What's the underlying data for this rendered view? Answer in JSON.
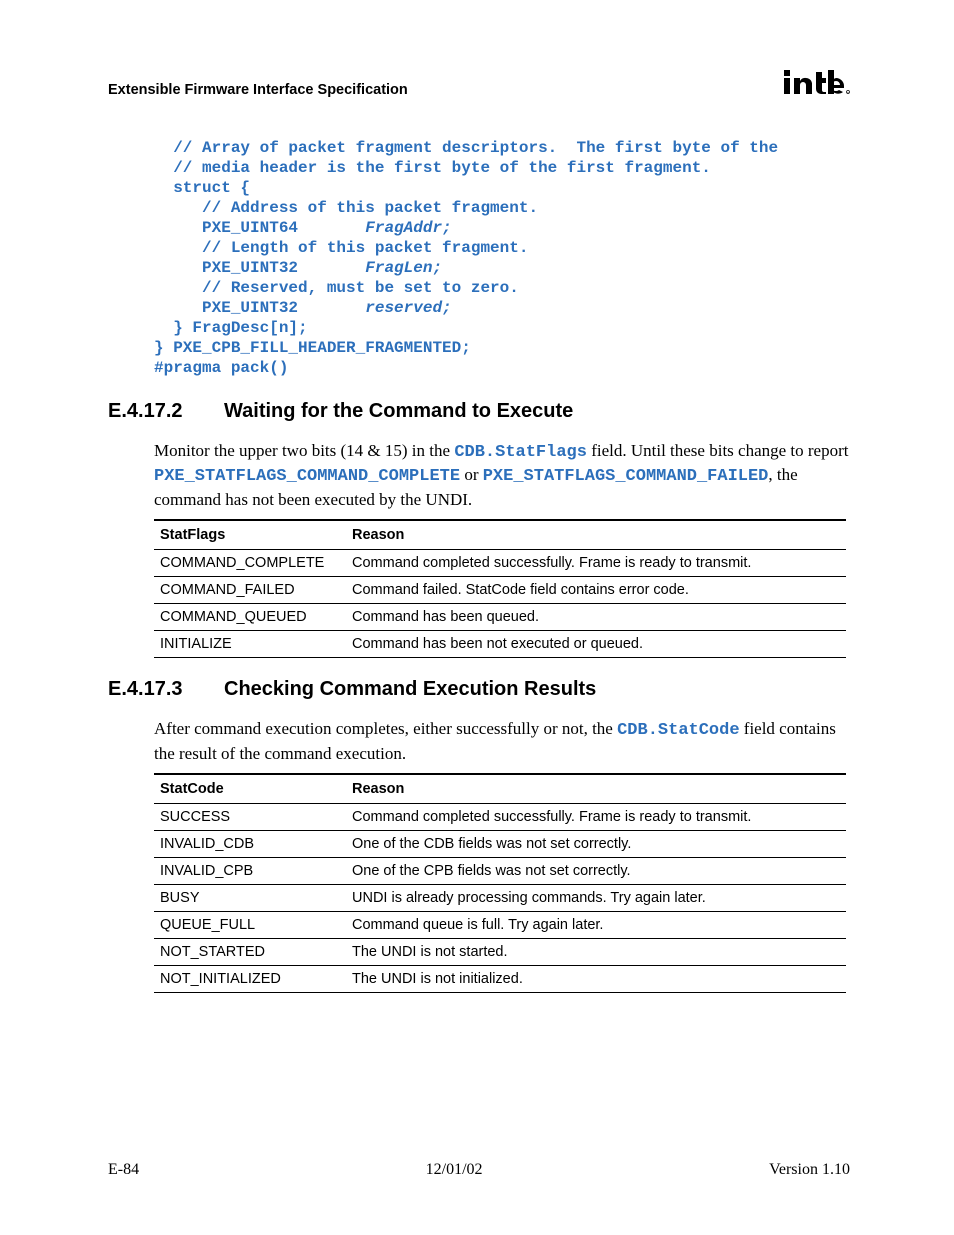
{
  "header": {
    "doc_title": "Extensible Firmware Interface Specification"
  },
  "code": {
    "l1": "  // Array of packet fragment descriptors.  The first byte of the",
    "l2": "  // media header is the first byte of the first fragment.",
    "blank1": "",
    "l3": "  struct {",
    "blank2": "",
    "l4": "     // Address of this packet fragment.",
    "l5a": "     PXE_UINT64       ",
    "l5b": "FragAddr;",
    "blank3": "",
    "l6": "     // Length of this packet fragment.",
    "l7a": "     PXE_UINT32       ",
    "l7b": "FragLen;",
    "blank4": "",
    "l8": "     // Reserved, must be set to zero.",
    "l9a": "     PXE_UINT32       ",
    "l9b": "reserved;",
    "l10": "  } FragDesc[n];",
    "l11": "} PXE_CPB_FILL_HEADER_FRAGMENTED;",
    "l12": "#pragma pack()"
  },
  "section1": {
    "num": "E.4.17.2",
    "title": "Waiting for the Command to Execute",
    "para_pre": "Monitor the upper two bits (14 & 15) in the ",
    "para_m1": "CDB.StatFlags",
    "para_mid": " field.  Until these bits change to report ",
    "para_m2": "PXE_STATFLAGS_COMMAND_COMPLETE",
    "para_or": " or ",
    "para_m3": "PXE_STATFLAGS_COMMAND_FAILED",
    "para_post": ", the command has not been executed by the UNDI.",
    "table": {
      "h1": "StatFlags",
      "h2": "Reason",
      "rows": [
        {
          "c1": "COMMAND_COMPLETE",
          "c2": "Command completed successfully.  Frame is ready to transmit."
        },
        {
          "c1": "COMMAND_FAILED",
          "c2": "Command failed.  StatCode field contains error code."
        },
        {
          "c1": "COMMAND_QUEUED",
          "c2": "Command has been queued."
        },
        {
          "c1": "INITIALIZE",
          "c2": "Command has been not executed or queued."
        }
      ]
    }
  },
  "section2": {
    "num": "E.4.17.3",
    "title": "Checking Command Execution Results",
    "para_pre": "After command execution completes, either successfully or not, the ",
    "para_m1": "CDB.StatCode",
    "para_post": " field contains the result of the command execution.",
    "table": {
      "h1": "StatCode",
      "h2": "Reason",
      "rows": [
        {
          "c1": "SUCCESS",
          "c2": "Command completed successfully.  Frame is ready to transmit."
        },
        {
          "c1": "INVALID_CDB",
          "c2": "One of the CDB fields was not set correctly."
        },
        {
          "c1": "INVALID_CPB",
          "c2": "One of the CPB fields was not set correctly."
        },
        {
          "c1": "BUSY",
          "c2": "UNDI is already processing commands.  Try again later."
        },
        {
          "c1": "QUEUE_FULL",
          "c2": "Command queue is full.  Try again later."
        },
        {
          "c1": "NOT_STARTED",
          "c2": "The UNDI is not started."
        },
        {
          "c1": "NOT_INITIALIZED",
          "c2": "The UNDI is not initialized."
        }
      ]
    }
  },
  "footer": {
    "left": "E-84",
    "center": "12/01/02",
    "right": "Version 1.10"
  }
}
